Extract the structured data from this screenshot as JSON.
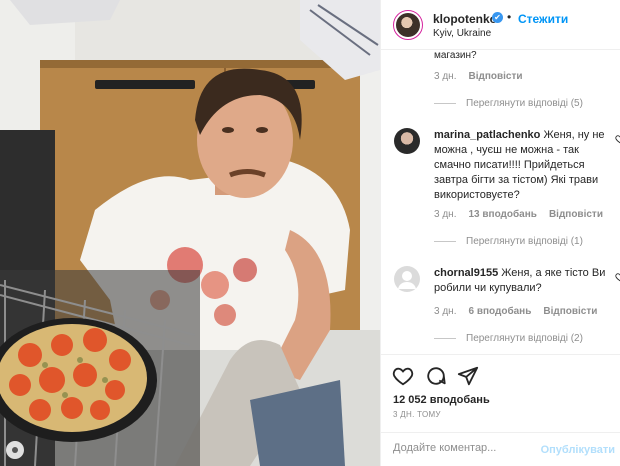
{
  "post": {
    "username": "klopotenko",
    "verified_mark": "✔",
    "separator": "•",
    "follow_label": "Стежити",
    "location": "Kyiv, Ukraine"
  },
  "comments": {
    "cut_text": "магазин?",
    "first_meta": {
      "time": "3 дн.",
      "reply_label": "Відповісти",
      "view_replies": "Переглянути відповіді (5)"
    },
    "items": [
      {
        "author": "marina_patlachenko",
        "text": "Женя, ну не можна , чуєш не можна - так смачно писати!!!! Прийдеться завтра бігти за тістом) Які трави використовуєте?",
        "time": "3 дн.",
        "likes": "13 вподобань",
        "reply_label": "Відповісти",
        "view_replies": "Переглянути відповіді (1)",
        "avatar_icon": "user-photo"
      },
      {
        "author": "chornal9155",
        "text": "Женя, а яке тісто Ви робили чи купували?",
        "time": "3 дн.",
        "likes": "6 вподобань",
        "reply_label": "Відповісти",
        "view_replies": "Переглянути відповіді (2)",
        "avatar_icon": "default-avatar-icon"
      }
    ]
  },
  "actions": {
    "like_icon": "heart-icon",
    "comment_icon": "comment-icon",
    "share_icon": "share-icon",
    "likes": "12 052 вподобань",
    "time_ago": "3 ДН. ТОМУ"
  },
  "add_comment": {
    "placeholder": "Додайте коментар...",
    "publish_label": "Опублікувати"
  },
  "colors": {
    "accent": "#0095f6",
    "verified": "#3897f0",
    "muted": "#8e8e8e",
    "publish_disabled": "#b2dffc"
  }
}
